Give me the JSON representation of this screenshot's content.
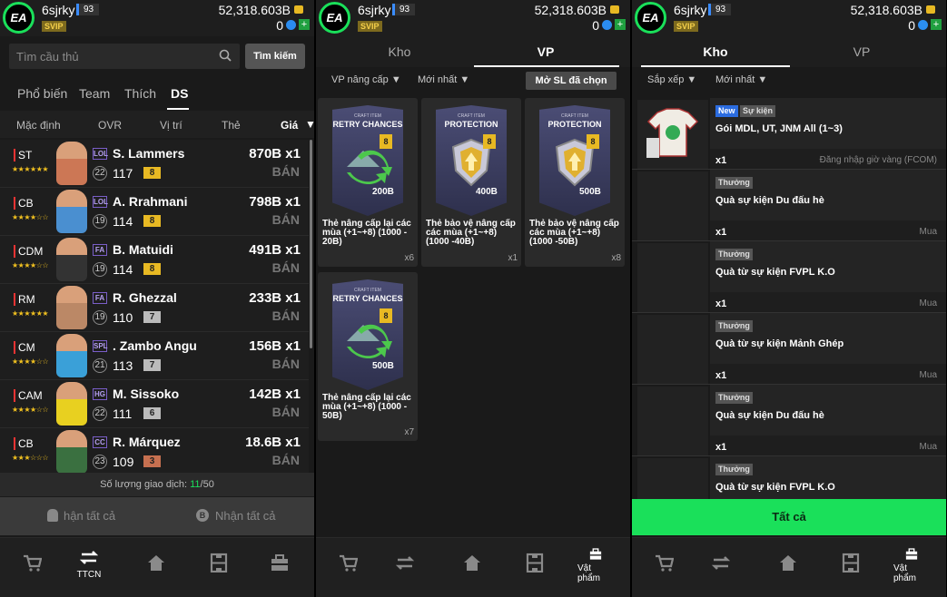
{
  "header": {
    "username": "6sjrky",
    "level": "93",
    "vip": "SVIP",
    "balance": "52,318.603B",
    "count": "0"
  },
  "p1": {
    "search_placeholder": "Tìm cầu thủ",
    "search_btn": "Tìm kiếm",
    "tabs": [
      "Phổ biến",
      "Team",
      "Thích",
      "DS"
    ],
    "cols": [
      "Mặc định",
      "OVR",
      "Vị trí",
      "Thẻ",
      "Giá"
    ],
    "players": [
      {
        "pos": "ST",
        "stars": "★★★★★★",
        "tag": "LOL",
        "name": "S. Lammers",
        "rank": "22",
        "ovr": "117",
        "upg": "8",
        "price": "870B x1",
        "sell": "BÁN",
        "face": "#c75",
        "upgcolor": "#e8b923"
      },
      {
        "pos": "CB",
        "stars": "★★★★☆☆",
        "tag": "LOL",
        "name": "A. Rrahmani",
        "rank": "19",
        "ovr": "114",
        "upg": "8",
        "price": "798B x1",
        "sell": "BÁN",
        "face": "#4a8fd0",
        "upgcolor": "#e8b923"
      },
      {
        "pos": "CDM",
        "stars": "★★★★☆☆",
        "tag": "FA",
        "name": "B. Matuidi",
        "rank": "19",
        "ovr": "114",
        "upg": "8",
        "price": "491B x1",
        "sell": "BÁN",
        "face": "#333",
        "upgcolor": "#e8b923"
      },
      {
        "pos": "RM",
        "stars": "★★★★★★",
        "tag": "FA",
        "name": "R. Ghezzal",
        "rank": "19",
        "ovr": "110",
        "upg": "7",
        "price": "233B x1",
        "sell": "BÁN",
        "face": "#b86",
        "upgcolor": "#bbb"
      },
      {
        "pos": "CM",
        "stars": "★★★★☆☆",
        "tag": "SPL",
        "name": ". Zambo Angu",
        "rank": "21",
        "ovr": "113",
        "upg": "7",
        "price": "156B x1",
        "sell": "BÁN",
        "face": "#3aa0d8",
        "upgcolor": "#bbb"
      },
      {
        "pos": "CAM",
        "stars": "★★★★☆☆",
        "tag": "HG",
        "name": "M. Sissoko",
        "rank": "22",
        "ovr": "111",
        "upg": "6",
        "price": "142B x1",
        "sell": "BÁN",
        "face": "#e8d020",
        "upgcolor": "#bbb"
      },
      {
        "pos": "CB",
        "stars": "★★★☆☆☆",
        "tag": "CC",
        "name": "R. Márquez",
        "rank": "23",
        "ovr": "109",
        "upg": "3",
        "price": "18.6B x1",
        "sell": "BÁN",
        "face": "#3a7040",
        "upgcolor": "#c67050"
      }
    ],
    "quota_label": "Số lượng giao dịch: ",
    "quota_val": "11",
    "quota_max": "/50",
    "claim1": "hận tất cả",
    "claim2": "Nhận tất cả",
    "nav_active": "TTCN"
  },
  "p2": {
    "tabs": [
      "Kho",
      "VP"
    ],
    "filter1": "VP nâng cấp ▼",
    "filter2": "Mới nhất ▼",
    "open_btn": "Mở SL đã chọn",
    "cards": [
      {
        "title": "RETRY CHANCES",
        "craft": "CRAFT ITEM",
        "val": "200B",
        "desc": "Thẻ nâng cấp lại các mùa (+1~+8) (1000 - 20B)",
        "qty": "x6"
      },
      {
        "title": "PROTECTION",
        "craft": "CRAFT ITEM",
        "val": "400B",
        "desc": "Thẻ bảo vệ nâng cấp các mùa (+1~+8) (1000 -40B)",
        "qty": "x1"
      },
      {
        "title": "PROTECTION",
        "craft": "CRAFT ITEM",
        "val": "500B",
        "desc": "Thẻ bảo vệ nâng cấp các mùa (+1~+8) (1000 -50B)",
        "qty": "x8"
      },
      {
        "title": "RETRY CHANCES",
        "craft": "CRAFT ITEM",
        "val": "500B",
        "desc": "Thẻ nâng cấp lại các mùa (+1~+8) (1000 - 50B)",
        "qty": "x7"
      }
    ],
    "nav_active": "Vật phẩm"
  },
  "p3": {
    "tabs": [
      "Kho",
      "VP"
    ],
    "filter1": "Sắp xếp ▼",
    "filter2": "Mới nhất ▼",
    "items": [
      {
        "badges": [
          "New",
          "Sự kiện"
        ],
        "title": "Gói MDL, UT, JNM All (1~3)",
        "qty": "x1",
        "action": "Đăng nhập giờ vàng (FCOM)"
      },
      {
        "badges": [
          "Thưởng"
        ],
        "title": "Quà sự kiện Du đấu hè",
        "qty": "x1",
        "action": "Mua"
      },
      {
        "badges": [
          "Thưởng"
        ],
        "title": "Quà từ sự kiện FVPL K.O",
        "qty": "x1",
        "action": "Mua"
      },
      {
        "badges": [
          "Thưởng"
        ],
        "title": "Quà từ sự kiện Mảnh Ghép",
        "qty": "x1",
        "action": "Mua"
      },
      {
        "badges": [
          "Thưởng"
        ],
        "title": "Quà sự kiện Du đấu hè",
        "qty": "x1",
        "action": "Mua"
      },
      {
        "badges": [
          "Thưởng"
        ],
        "title": "Quà từ sự kiện FVPL K.O",
        "qty": "",
        "action": ""
      }
    ],
    "all_btn": "Tất cả",
    "nav_active": "Vật phẩm"
  },
  "colors": {
    "accent": "#1ae05a",
    "bg": "#1a1a1a"
  },
  "nav_icons": [
    "cart-icon",
    "transfer-icon",
    "home-icon",
    "formation-icon",
    "bag-icon"
  ]
}
